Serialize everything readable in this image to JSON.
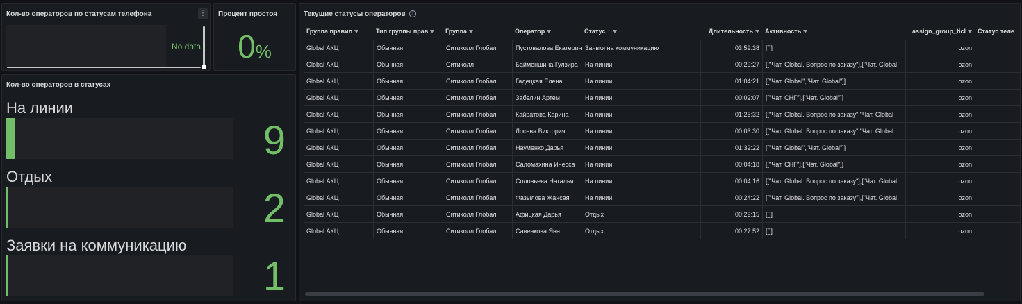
{
  "panel_phone_status": {
    "title": "Кол-во операторов по статусам телефона",
    "empty_text": "No data",
    "menu_icon": "kebab-menu-icon"
  },
  "panel_idle": {
    "title": "Процент простоя",
    "value": "0",
    "unit": "%"
  },
  "panel_status_counts": {
    "title": "Кол-во операторов в статусах",
    "items": [
      {
        "label": "На линии",
        "value": "9",
        "fill_fraction": 0.04
      },
      {
        "label": "Отдых",
        "value": "2",
        "fill_fraction": 0.01
      },
      {
        "label": "Заявки на коммуникацию",
        "value": "1",
        "fill_fraction": 0.005
      }
    ],
    "accent_color": "#73bf69"
  },
  "panel_current_statuses": {
    "title": "Текущие статусы операторов",
    "info_icon": "info-icon",
    "columns": [
      {
        "label": "Группа правил",
        "filter": true
      },
      {
        "label": "Тип группы прав",
        "filter": true
      },
      {
        "label": "Группа",
        "filter": true
      },
      {
        "label": "Оператор",
        "filter": true
      },
      {
        "label": "Статус",
        "filter": true,
        "sort": "↑"
      },
      {
        "label": "Длительность",
        "filter": true
      },
      {
        "label": "Активность",
        "filter": true
      },
      {
        "label": "assign_group_ticl",
        "filter": true
      },
      {
        "label": "Статус теле",
        "filter": false
      }
    ],
    "rows": [
      [
        "Global АКЦ",
        "Обычная",
        "Ситиколл Глобал",
        "Пустовалова Екатерина",
        "Заявки на коммуникацию",
        "03:59:38",
        "[[]]",
        "ozon",
        ""
      ],
      [
        "Global АКЦ",
        "Обычная",
        "Ситиколл",
        "Байменшина Гулзира",
        "На линии",
        "00:29:27",
        "[[\"Чат. Global. Вопрос по заказу\"],[\"Чат. Global",
        "ozon",
        ""
      ],
      [
        "Global АКЦ",
        "Обычная",
        "Ситиколл Глобал",
        "Гадецкая Елена",
        "На линии",
        "01:04:21",
        "[[\"Чат. Global\",\"Чат. Global\"]]",
        "ozon",
        ""
      ],
      [
        "Global АКЦ",
        "Обычная",
        "Ситиколл Глобал",
        "Забелин Артем",
        "На линии",
        "00:02:07",
        "[[\"Чат. СНГ\"],[\"Чат. Global\"]]",
        "ozon",
        ""
      ],
      [
        "Global АКЦ",
        "Обычная",
        "Ситиколл Глобал",
        "Кайратова Карина",
        "На линии",
        "01:25:32",
        "[[\"Чат. Global. Вопрос по заказу\",\"Чат. Global",
        "ozon",
        ""
      ],
      [
        "Global АКЦ",
        "Обычная",
        "Ситиколл Глобал",
        "Лосева Виктория",
        "На линии",
        "00:03:30",
        "[[\"Чат. Global. Вопрос по заказу\",\"Чат. Global",
        "ozon",
        ""
      ],
      [
        "Global АКЦ",
        "Обычная",
        "Ситиколл Глобал",
        "Науменко Дарья",
        "На линии",
        "01:32:22",
        "[[\"Чат. Global\",\"Чат. Global\"]]",
        "ozon",
        ""
      ],
      [
        "Global АКЦ",
        "Обычная",
        "Ситиколл Глобал",
        "Саломахина Инесса",
        "На линии",
        "00:04:18",
        "[[\"Чат. СНГ\"],[\"Чат. Global\"]]",
        "ozon",
        ""
      ],
      [
        "Global АКЦ",
        "Обычная",
        "Ситиколл Глобал",
        "Соловьева Наталья",
        "На линии",
        "00:04:16",
        "[[\"Чат. Global. Вопрос по заказу\"],[\"Чат. Global",
        "ozon",
        ""
      ],
      [
        "Global АКЦ",
        "Обычная",
        "Ситиколл Глобал",
        "Фазылова Жансая",
        "На линии",
        "00:24:22",
        "[[\"Чат. Global. Вопрос по заказу\"],[\"Чат. Global",
        "ozon",
        ""
      ],
      [
        "Global АКЦ",
        "Обычная",
        "Ситиколл Глобал",
        "Афицкая Дарья",
        "Отдых",
        "00:29:15",
        "[[]]",
        "ozon",
        ""
      ],
      [
        "Global АКЦ",
        "Обычная",
        "Ситиколл Глобал",
        "Савенкова Яна",
        "Отдых",
        "00:27:52",
        "[[]]",
        "ozon",
        ""
      ]
    ]
  }
}
